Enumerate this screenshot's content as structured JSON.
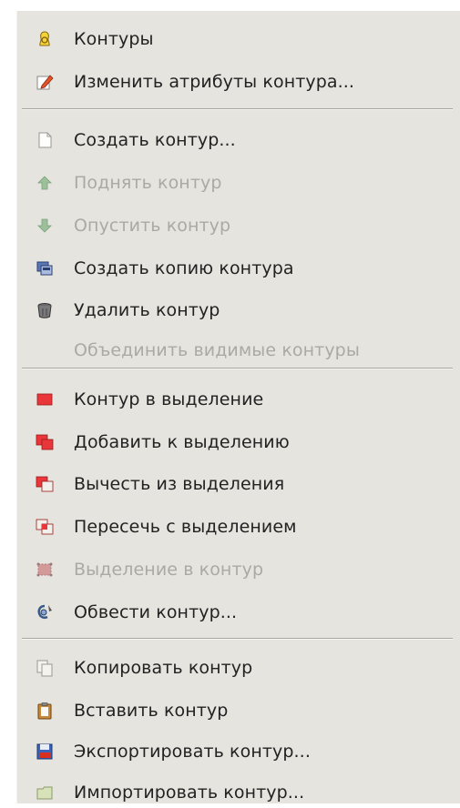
{
  "menu": {
    "items": [
      {
        "label": "Контуры",
        "icon": "paths-icon",
        "enabled": true
      },
      {
        "label": "Изменить атрибуты контура...",
        "icon": "edit-attributes-icon",
        "enabled": true
      },
      {
        "label": "Создать контур...",
        "icon": "new-path-icon",
        "enabled": true
      },
      {
        "label": "Поднять контур",
        "icon": "raise-arrow-icon",
        "enabled": false
      },
      {
        "label": "Опустить контур",
        "icon": "lower-arrow-icon",
        "enabled": false
      },
      {
        "label": "Создать копию контура",
        "icon": "duplicate-path-icon",
        "enabled": true
      },
      {
        "label": "Удалить контур",
        "icon": "trash-icon",
        "enabled": true
      },
      {
        "label": "Объединить видимые контуры",
        "icon": "",
        "enabled": false
      },
      {
        "label": "Контур в выделение",
        "icon": "path-to-selection-icon",
        "enabled": true
      },
      {
        "label": "Добавить к выделению",
        "icon": "add-to-selection-icon",
        "enabled": true
      },
      {
        "label": "Вычесть из выделения",
        "icon": "subtract-from-selection-icon",
        "enabled": true
      },
      {
        "label": "Пересечь с выделением",
        "icon": "intersect-selection-icon",
        "enabled": true
      },
      {
        "label": "Выделение в контур",
        "icon": "selection-to-path-icon",
        "enabled": false
      },
      {
        "label": "Обвести контур...",
        "icon": "stroke-path-icon",
        "enabled": true
      },
      {
        "label": "Копировать контур",
        "icon": "copy-path-icon",
        "enabled": true
      },
      {
        "label": "Вставить контур",
        "icon": "paste-path-icon",
        "enabled": true
      },
      {
        "label": "Экспортировать контур...",
        "icon": "export-path-icon",
        "enabled": true
      },
      {
        "label": "Импортировать контур...",
        "icon": "import-path-icon",
        "enabled": true
      }
    ]
  }
}
